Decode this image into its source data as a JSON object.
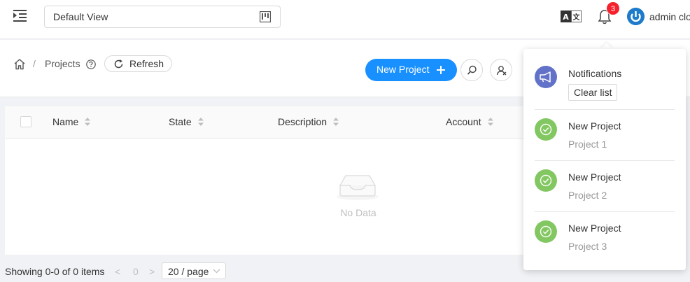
{
  "topbar": {
    "view_select": {
      "value": "Default View"
    },
    "notifications_badge": "3",
    "user_name": "admin cloud"
  },
  "breadcrumb": {
    "separator": "/",
    "current": "Projects"
  },
  "header": {
    "refresh_label": "Refresh",
    "new_project_label": "New Project"
  },
  "table": {
    "columns": [
      "Name",
      "State",
      "Description",
      "Account"
    ],
    "empty_text": "No Data"
  },
  "pagination": {
    "total_text": "Showing 0-0 of 0 items",
    "prev": "<",
    "current_page": "0",
    "next": ">",
    "page_size": "20 / page"
  },
  "notifications": {
    "title": "Notifications",
    "clear_label": "Clear list",
    "items": [
      {
        "title": "New Project",
        "subtitle": "Project 1"
      },
      {
        "title": "New Project",
        "subtitle": "Project 2"
      },
      {
        "title": "New Project",
        "subtitle": "Project 3"
      }
    ]
  },
  "colors": {
    "primary": "#1890ff",
    "badge": "#f5222d",
    "success": "#82c761",
    "notice": "#6272c8"
  }
}
